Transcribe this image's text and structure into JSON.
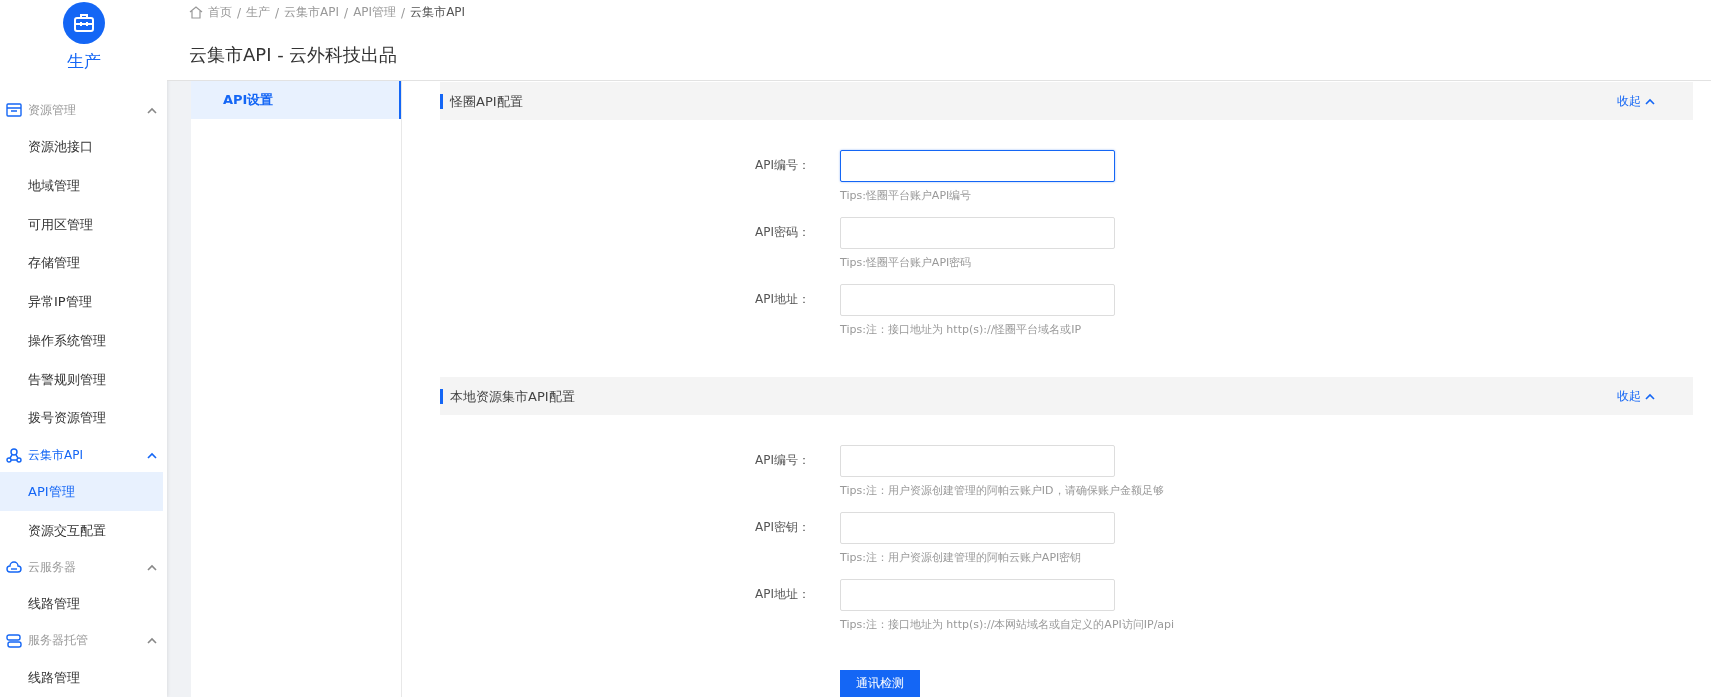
{
  "sidebar": {
    "app_title": "生产",
    "groups": [
      {
        "label": "资源管理",
        "active": false,
        "expanded": true,
        "items": [
          {
            "label": "资源池接口",
            "selected": false
          },
          {
            "label": "地域管理",
            "selected": false
          },
          {
            "label": "可用区管理",
            "selected": false
          },
          {
            "label": "存储管理",
            "selected": false
          },
          {
            "label": "异常IP管理",
            "selected": false
          },
          {
            "label": "操作系统管理",
            "selected": false
          },
          {
            "label": "告警规则管理",
            "selected": false
          },
          {
            "label": "拨号资源管理",
            "selected": false
          }
        ]
      },
      {
        "label": "云集市API",
        "active": true,
        "expanded": true,
        "items": [
          {
            "label": "API管理",
            "selected": true
          },
          {
            "label": "资源交互配置",
            "selected": false
          }
        ]
      },
      {
        "label": "云服务器",
        "active": false,
        "expanded": true,
        "items": [
          {
            "label": "线路管理",
            "selected": false
          }
        ]
      },
      {
        "label": "服务器托管",
        "active": false,
        "expanded": true,
        "items": [
          {
            "label": "线路管理",
            "selected": false
          }
        ]
      }
    ]
  },
  "breadcrumb": {
    "separator": "/",
    "items": [
      "首页",
      "生产",
      "云集市API",
      "API管理",
      "云集市API"
    ]
  },
  "page_title": "云集市API - 云外科技出品",
  "settings_nav": [
    {
      "label": "API设置",
      "selected": true
    }
  ],
  "sections": [
    {
      "title": "怪圈API配置",
      "toggle": "收起",
      "expanded": true,
      "fields": [
        {
          "label": "API编号：",
          "focused": true,
          "tip": "Tips:怪圈平台账户API编号"
        },
        {
          "label": "API密码：",
          "focused": false,
          "tip": "Tips:怪圈平台账户API密码"
        },
        {
          "label": "API地址：",
          "focused": false,
          "tip": "Tips:注：接口地址为 http(s)://怪圈平台域名或IP"
        }
      ]
    },
    {
      "title": "本地资源集市API配置",
      "toggle": "收起",
      "expanded": true,
      "fields": [
        {
          "label": "API编号：",
          "focused": false,
          "tip": "Tips:注：用户资源创建管理的阿帕云账户ID，请确保账户金额足够"
        },
        {
          "label": "API密钥：",
          "focused": false,
          "tip": "Tips:注：用户资源创建管理的阿帕云账户API密钥"
        },
        {
          "label": "API地址：",
          "focused": false,
          "tip": "Tips:注：接口地址为 http(s)://本网站域名或自定义的API访问IP/api"
        }
      ]
    }
  ],
  "submit_button": "通讯检测"
}
